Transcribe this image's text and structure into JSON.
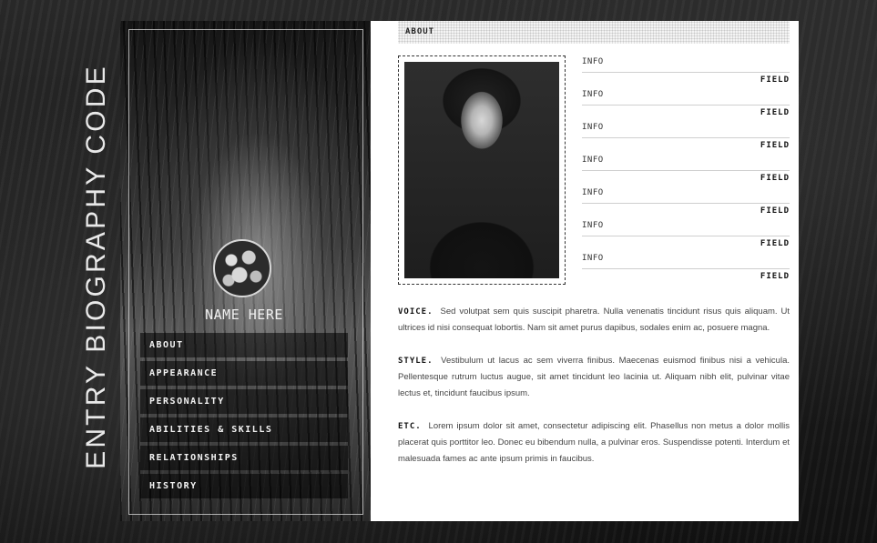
{
  "page": {
    "vertical_title": "ENTRY BIOGRAPHY CODE"
  },
  "sidebar": {
    "name": "NAME HERE",
    "nav": [
      {
        "label": "ABOUT"
      },
      {
        "label": "APPEARANCE"
      },
      {
        "label": "PERSONALITY"
      },
      {
        "label": "ABILITIES & SKILLS"
      },
      {
        "label": "RELATIONSHIPS"
      },
      {
        "label": "HISTORY"
      }
    ]
  },
  "content": {
    "tab_label": "ABOUT",
    "fields": [
      {
        "label": "INFO",
        "value": "FIELD"
      },
      {
        "label": "INFO",
        "value": "FIELD"
      },
      {
        "label": "INFO",
        "value": "FIELD"
      },
      {
        "label": "INFO",
        "value": "FIELD"
      },
      {
        "label": "INFO",
        "value": "FIELD"
      },
      {
        "label": "INFO",
        "value": "FIELD"
      },
      {
        "label": "INFO",
        "value": "FIELD"
      }
    ],
    "sections": [
      {
        "heading": "VOICE.",
        "body": "Sed volutpat sem quis suscipit pharetra. Nulla venenatis tincidunt risus quis aliquam. Ut ultrices id nisi consequat lobortis. Nam sit amet purus dapibus, sodales enim ac, posuere magna."
      },
      {
        "heading": "STYLE.",
        "body": "Vestibulum ut lacus ac sem viverra finibus. Maecenas euismod finibus nisi a vehicula. Pellentesque rutrum luctus augue, sit amet tincidunt leo lacinia ut. Aliquam nibh elit, pulvinar vitae lectus et, tincidunt faucibus ipsum."
      },
      {
        "heading": "ETC.",
        "body": "Lorem ipsum dolor sit amet, consectetur adipiscing elit. Phasellus non metus a dolor mollis placerat quis porttitor leo. Donec eu bibendum nulla, a pulvinar eros. Suspendisse potenti. Interdum et malesuada fames ac ante ipsum primis in faucibus."
      }
    ]
  },
  "icons": {
    "avatar": "skulls-avatar-icon",
    "photo": "portrait-photo"
  },
  "colors": {
    "panel_bg": "#ffffff",
    "text": "#444444",
    "nav_bg": "#000000"
  }
}
